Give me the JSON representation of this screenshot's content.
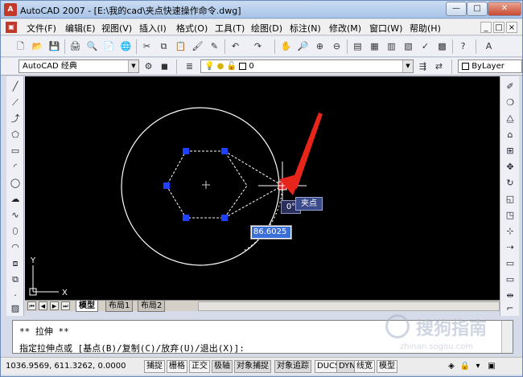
{
  "window": {
    "app_icon_letter": "A",
    "title": "AutoCAD 2007 - [E:\\我的cad\\夹点快速操作命令.dwg]",
    "buttons": {
      "minimize": "—",
      "maximize": "□",
      "close": "✕"
    }
  },
  "menubar": {
    "items": [
      "文件(F)",
      "编辑(E)",
      "视图(V)",
      "插入(I)",
      "格式(O)",
      "工具(T)",
      "绘图(D)",
      "标注(N)",
      "修改(M)",
      "窗口(W)",
      "帮助(H)"
    ],
    "mdi_buttons": [
      "_",
      "□",
      "×"
    ]
  },
  "toolbar_workspace": {
    "workspace": "AutoCAD 经典",
    "layer_name": "0",
    "color": "ByLayer"
  },
  "drawing": {
    "ucs_y": "Y",
    "ucs_x": "X",
    "angle_tooltip": "0°",
    "grip_tooltip": "夹点",
    "dimension_input": "86.6025",
    "colors": {
      "background": "#000000",
      "grip_selected": "#e02020",
      "grip_cold": "#2040ff",
      "geometry": "#ffffff",
      "arrow": "#e8251b"
    }
  },
  "layout_tabs": {
    "nav": [
      "⏮",
      "◀",
      "▶",
      "⏭"
    ],
    "tabs": [
      "模型",
      "布局1",
      "布局2"
    ],
    "active": "模型"
  },
  "command": {
    "line1": "** 拉伸 **",
    "line2": "指定拉伸点或 [基点(B)/复制(C)/放弃(U)/退出(X)]:"
  },
  "statusbar": {
    "coords": "1036.9569, 611.3262, 0.0000",
    "toggles": [
      "捕捉",
      "栅格",
      "正交",
      "极轴",
      "对象捕捉",
      "对象追踪",
      "DUCS",
      "DYN",
      "线宽",
      "模型"
    ]
  },
  "watermark": {
    "text": "搜狗指南",
    "sub": "zhinan.sogou.com"
  }
}
